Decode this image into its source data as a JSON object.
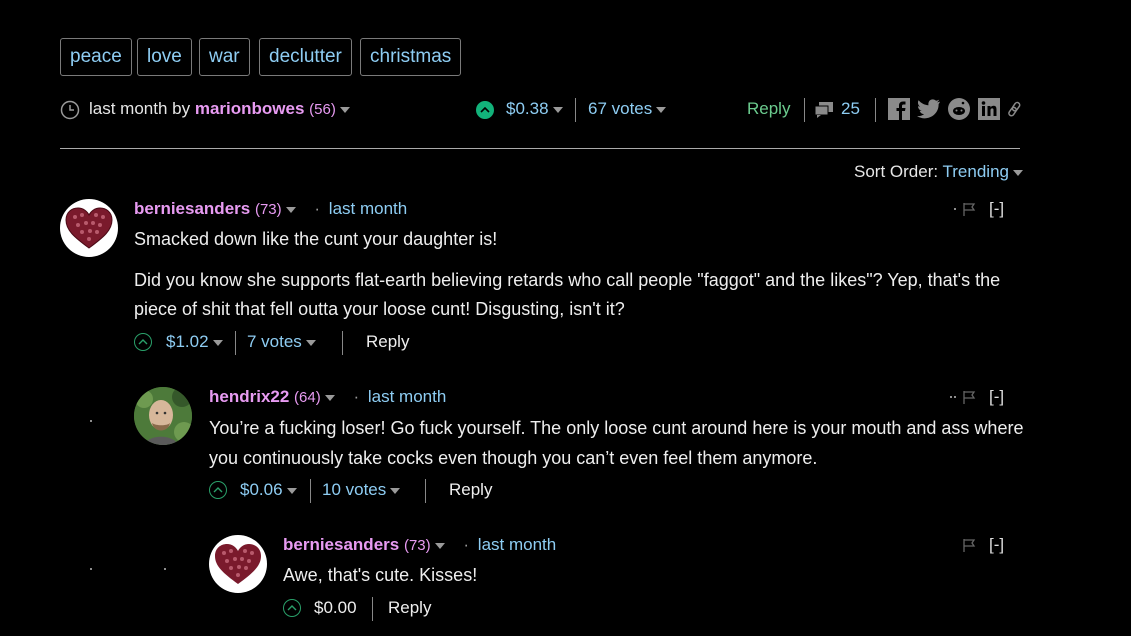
{
  "tags": [
    "peace",
    "love",
    "war",
    "declutter",
    "christmas"
  ],
  "post": {
    "time": "last month by",
    "author": "marionbowes",
    "rep": "(56)",
    "payout": "$0.38",
    "votes": "67 votes",
    "reply": "Reply",
    "comment_count": "25"
  },
  "sort": {
    "label": "Sort Order:",
    "value": "Trending"
  },
  "comments": [
    {
      "author": "berniesanders",
      "rep": "(73)",
      "time": "last month",
      "paragraphs": [
        "Smacked down like the cunt your daughter is!",
        "Did you know she supports flat-earth believing retards who call people \"faggot\" and the likes\"? Yep, that's the piece of shit that fell outta your loose cunt! Disgusting, isn't it?"
      ],
      "payout": "$1.02",
      "votes": "7 votes",
      "reply": "Reply",
      "collapse": "[-]"
    },
    {
      "author": "hendrix22",
      "rep": "(64)",
      "time": "last month",
      "paragraphs": [
        "You’re a fucking loser! Go fuck yourself. The only loose cunt around here is your mouth and ass where you continuously take cocks even though you can’t even feel them anymore."
      ],
      "payout": "$0.06",
      "votes": "10 votes",
      "reply": "Reply",
      "collapse": "[-]"
    },
    {
      "author": "berniesanders",
      "rep": "(73)",
      "time": "last month",
      "paragraphs": [
        "Awe, that's cute. Kisses!"
      ],
      "payout": "$0.00",
      "reply": "Reply",
      "collapse": "[-]"
    }
  ]
}
